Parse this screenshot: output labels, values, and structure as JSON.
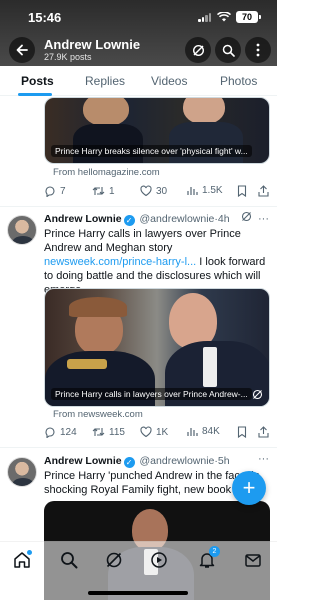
{
  "status_bar": {
    "time": "15:46",
    "battery": "70"
  },
  "header": {
    "title": "Andrew Lownie",
    "subtitle": "27.9K posts"
  },
  "tabs": [
    {
      "label": "Posts",
      "active": true
    },
    {
      "label": "Replies",
      "active": false
    },
    {
      "label": "Videos",
      "active": false
    },
    {
      "label": "Photos",
      "active": false
    }
  ],
  "tweet_prev": {
    "media_caption": "Prince Harry breaks silence over 'physical fight' w...",
    "link_source": "From hellomagazine.com",
    "replies": "7",
    "retweets": "1",
    "likes": "30",
    "views": "1.5K"
  },
  "tweet1": {
    "name": "Andrew Lownie",
    "handle": "@andrewlownie",
    "time": "4h",
    "text_before_link": "Prince Harry calls in lawyers over Prince Andrew and Meghan story ",
    "link": "newsweek.com/prince-harry-l...",
    "text_after_link": " I look forward to doing battle and the disclosures which will emerge.",
    "media_caption": "Prince Harry calls in lawyers over Prince Andrew-...",
    "link_source": "From newsweek.com",
    "replies": "124",
    "retweets": "115",
    "likes": "1K",
    "views": "84K"
  },
  "tweet2": {
    "name": "Andrew Lownie",
    "handle": "@andrewlownie",
    "time": "5h",
    "text": "Prince Harry 'punched Andrew in the face' in shocking Royal Family fight, new book claims"
  },
  "bottom_nav": {
    "notifications_badge": "2"
  },
  "colors": {
    "accent": "#1d9bf0",
    "text": "#0f1419",
    "muted": "#536471"
  }
}
